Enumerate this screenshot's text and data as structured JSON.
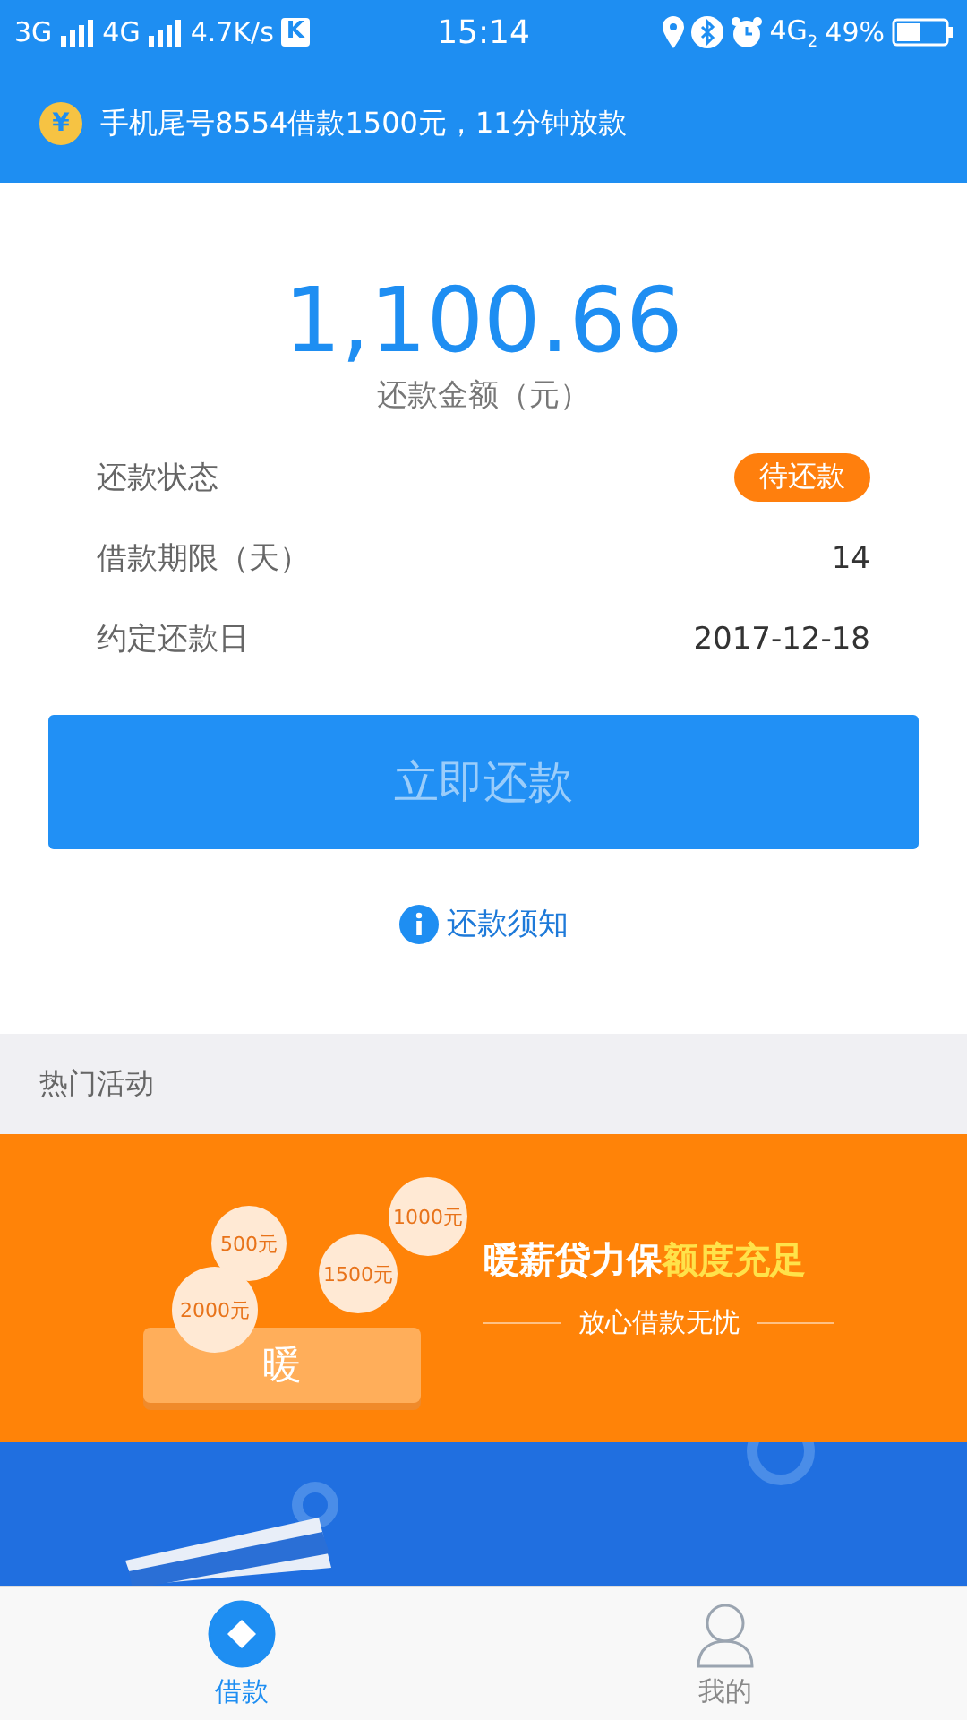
{
  "status_bar": {
    "network_1": "3G",
    "network_2": "4G",
    "speed": "4.7K/s",
    "app_badge": "K",
    "time": "15:14",
    "network_3": "4G",
    "network_3_sub": "2",
    "battery": "49%"
  },
  "notice": {
    "icon": "¥",
    "text": "手机尾号8554借款1500元，11分钟放款"
  },
  "repayment": {
    "amount": "1,100.66",
    "amount_label": "还款金额（元）",
    "rows": [
      {
        "kind": "badge",
        "label": "还款状态",
        "value": "待还款"
      },
      {
        "kind": "text",
        "label": "借款期限（天）",
        "value": "14"
      },
      {
        "kind": "text",
        "label": "约定还款日",
        "value": "2017-12-18"
      }
    ],
    "button": {
      "label": "立即还款",
      "disabled": true
    },
    "notice_link": "还款须知"
  },
  "hot_section": {
    "title": "热门活动",
    "banners": [
      {
        "kind": "loan-promo",
        "bubbles": [
          "500元",
          "1000元",
          "1500元",
          "2000元"
        ],
        "tablet_text": "暖",
        "headline": "暖薪贷力保",
        "headline_highlight": "额度充足",
        "subtitle": "放心借款无忧"
      },
      {
        "kind": "maintenance"
      }
    ]
  },
  "tabs": [
    {
      "label": "借款",
      "selected": true
    },
    {
      "label": "我的",
      "selected": false
    }
  ]
}
